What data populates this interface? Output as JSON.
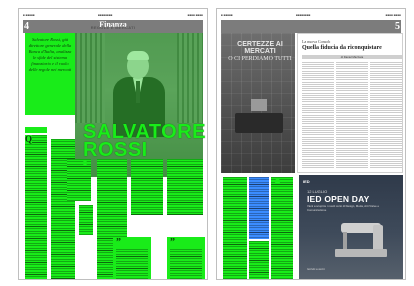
{
  "left_page": {
    "page_number": "4",
    "section_title": "Finanza",
    "section_subtitle": "REGOLE E MERCATI",
    "lead_text": "Salvatore Rossi, già direttore generale della Banca d'Italia, analizza le sfide del sistema finanziario e il ruolo delle regole nei mercati",
    "name_headline": "SALVATORE ROSSI",
    "dropcap": "Q",
    "pull_quote_mark": "”"
  },
  "right_page": {
    "page_number": "5",
    "ad_headline": "CERTEZZE AI MERCATI",
    "ad_subline": "O CI PERDIAMO TUTTI",
    "article_kicker": "La nuova Consob",
    "article_title": "Quella fiducia da riconquistare",
    "article_byline": "di Daniel Mazzara",
    "ied_ad": {
      "logo": "IED",
      "date": "12 LUGLIO",
      "title": "IED OPEN DAY",
      "subtitle": "Vieni a scoprire i nostri corsi di Design, Moda, Arti Visive e Comunicazione",
      "footer": "Iscriviti su ied.it"
    }
  },
  "colors": {
    "highlight": "#19ec19",
    "section_bar": "#7c7c7c"
  }
}
